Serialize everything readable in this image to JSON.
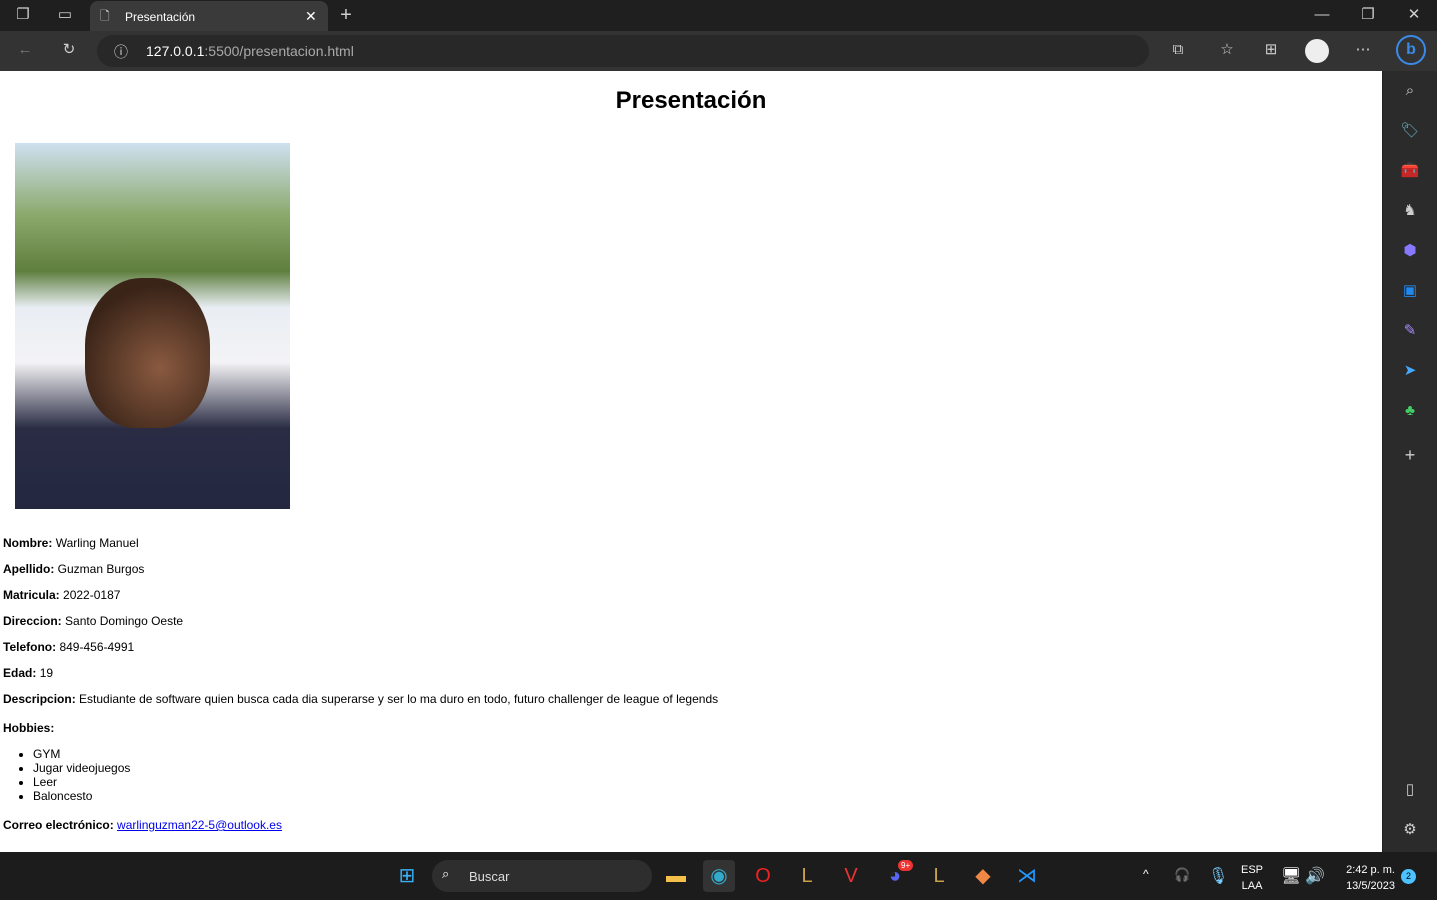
{
  "browser": {
    "tab_title": "Presentación",
    "url_host": "127.0.0.1",
    "url_rest": ":5500/presentacion.html"
  },
  "page": {
    "title": "Presentación",
    "fields": [
      {
        "label": "Nombre:",
        "value": "Warling Manuel"
      },
      {
        "label": "Apellido:",
        "value": "Guzman Burgos"
      },
      {
        "label": "Matricula:",
        "value": "2022-0187"
      },
      {
        "label": "Direccion:",
        "value": "Santo Domingo Oeste"
      },
      {
        "label": "Telefono:",
        "value": "849-456-4991"
      },
      {
        "label": "Edad:",
        "value": "19"
      },
      {
        "label": "Descripcion:",
        "value": "Estudiante de software quien busca cada dia superarse y ser lo ma duro en todo, futuro challenger de league of legends"
      }
    ],
    "hobbies_label": "Hobbies:",
    "hobbies": [
      "GYM",
      "Jugar videojuegos",
      "Leer",
      "Baloncesto"
    ],
    "email_label": "Correo electrónico:",
    "email": "warlinguzman22-5@outlook.es"
  },
  "taskbar": {
    "search": "Buscar",
    "lang1": "ESP",
    "lang2": "LAA",
    "time": "2:42 p. m.",
    "date": "13/5/2023",
    "notif": "2",
    "discord_badge": "9+"
  }
}
